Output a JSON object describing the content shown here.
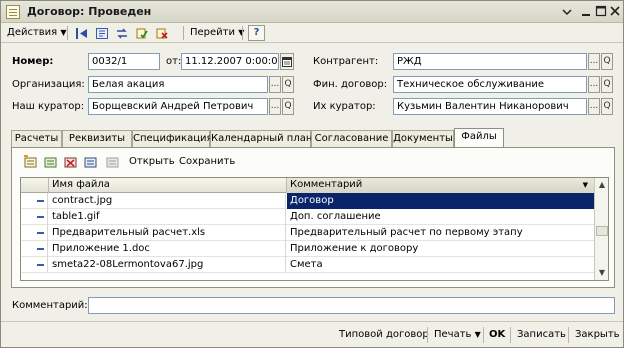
{
  "window": {
    "title": "Договор: Проведен"
  },
  "toolbar": {
    "actions_label": "Действия",
    "goto_label": "Перейти",
    "help_label": "?"
  },
  "header": {
    "number_label": "Номер:",
    "number_value": "0032/1",
    "date_label": "от:",
    "date_value": "11.12.2007  0:00:00",
    "org_label": "Организация:",
    "org_value": "Белая акация",
    "our_curator_label": "Наш куратор:",
    "our_curator_value": "Борщевский Андрей Петрович",
    "contractor_label": "Контрагент:",
    "contractor_value": "РЖД",
    "fin_contract_label": "Фин. договор:",
    "fin_contract_value": "Техническое обслуживание",
    "their_curator_label": "Их куратор:",
    "their_curator_value": "Кузьмин Валентин Никанорович",
    "lookup_btn": "...",
    "search_btn": "Q"
  },
  "tabs": [
    {
      "label": "Расчеты"
    },
    {
      "label": "Реквизиты"
    },
    {
      "label": "Спецификация"
    },
    {
      "label": "Календарный план"
    },
    {
      "label": "Согласование"
    },
    {
      "label": "Документы"
    },
    {
      "label": "Файлы",
      "active": true
    }
  ],
  "files_toolbar": {
    "open_label": "Открыть",
    "save_label": "Сохранить"
  },
  "grid": {
    "columns": [
      "Имя файла",
      "Комментарий"
    ],
    "rows": [
      {
        "name": "contract.jpg",
        "comment": "Договор",
        "selected": true
      },
      {
        "name": "table1.gif",
        "comment": "Доп. соглашение"
      },
      {
        "name": "Предварительный расчет.xls",
        "comment": "Предварительный расчет по первому этапу"
      },
      {
        "name": "Приложение 1.doc",
        "comment": "Приложение к договору"
      },
      {
        "name": "smeta22-08Lermontova67.jpg",
        "comment": "Смета"
      }
    ]
  },
  "footer": {
    "comment_label": "Комментарий:",
    "comment_value": "",
    "typical_contract_label": "Типовой договор",
    "print_label": "Печать",
    "ok_label": "OK",
    "write_label": "Записать",
    "close_label": "Закрыть"
  },
  "colors": {
    "selection": "#0a246a",
    "accent": "#3a5aa8"
  }
}
